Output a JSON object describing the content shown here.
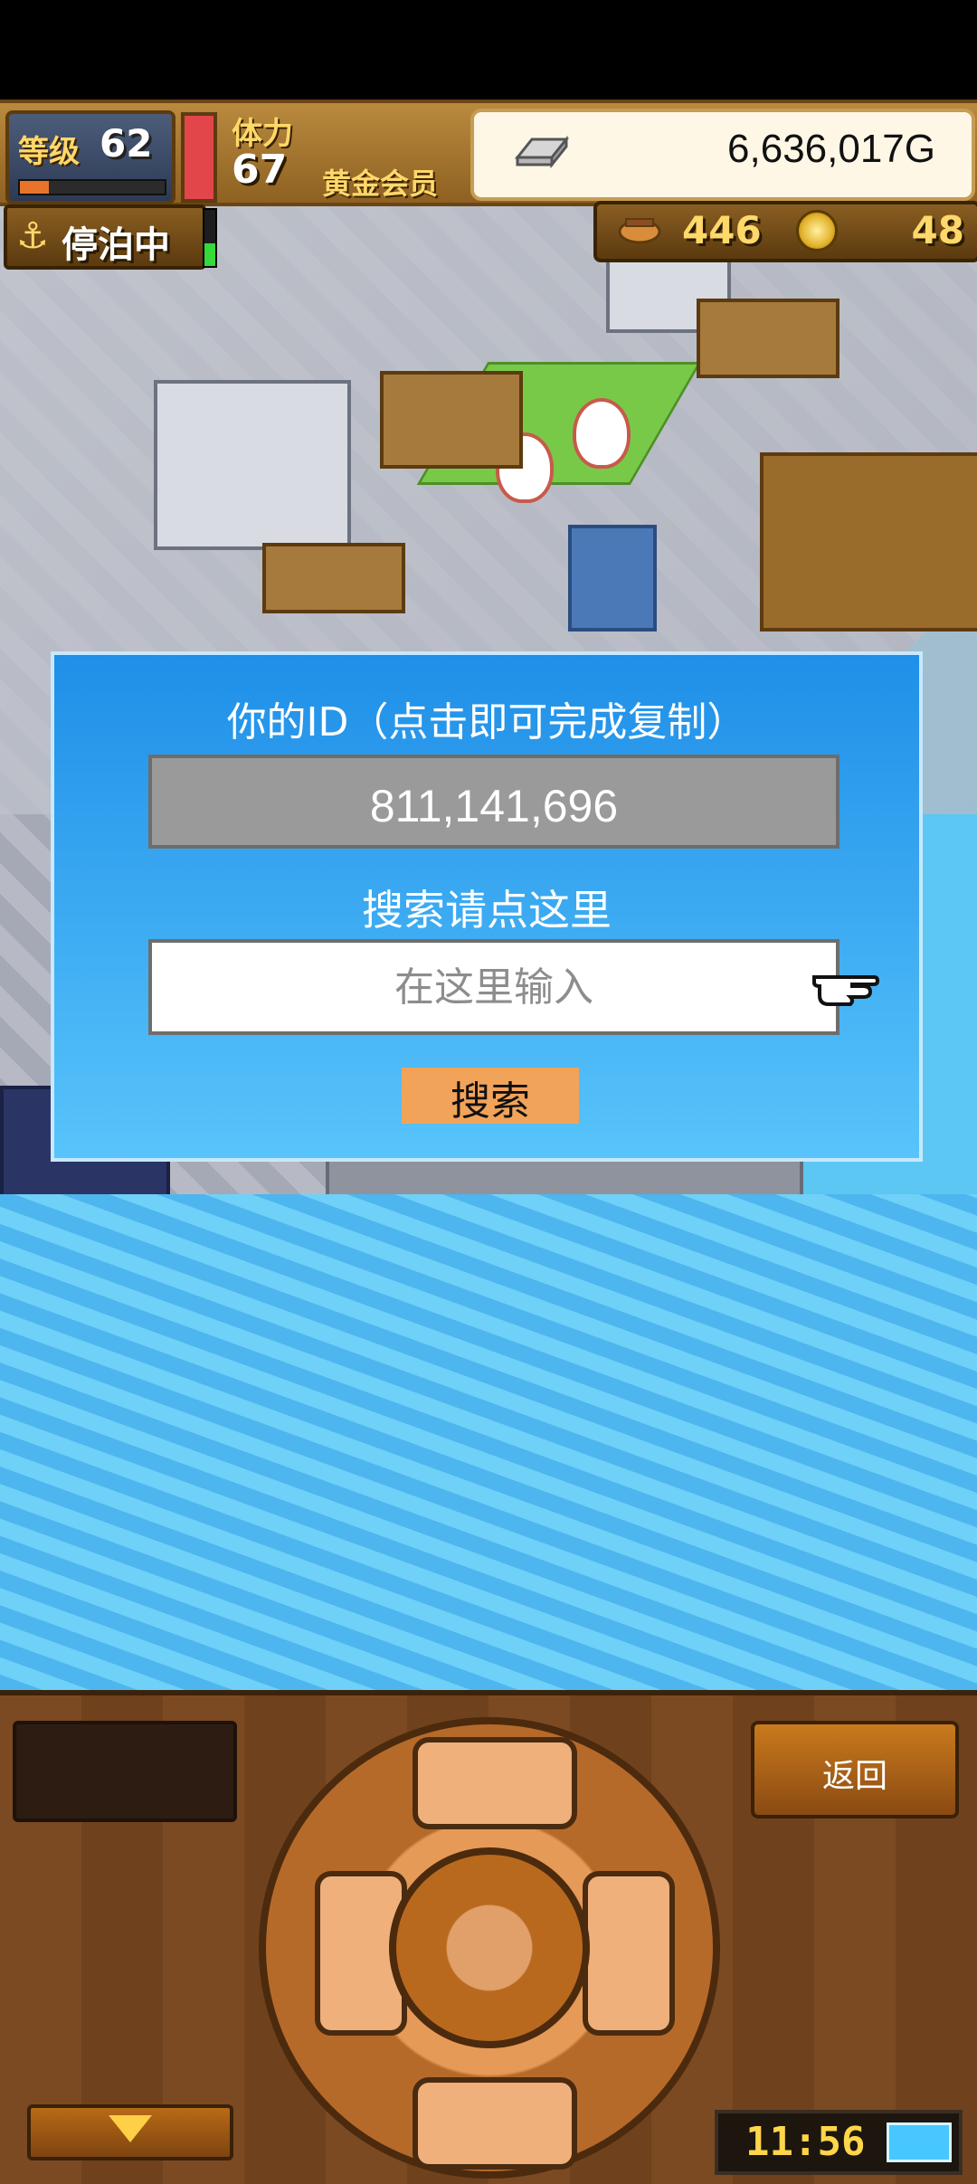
{
  "hud": {
    "level_label": "等级",
    "level_value": "62",
    "exp_progress": 0.2,
    "stamina_label": "体力",
    "stamina_value": "67",
    "stamina_progress": 1.0,
    "member_label": "黄金会员",
    "gold_value": "6,636,017G",
    "docked_label": "停泊中",
    "docked_indicator_progress": 0.4,
    "resource_1": "446",
    "resource_2": "48"
  },
  "dialog": {
    "id_title": "你的ID（点击即可完成复制）",
    "id_value": "811,141,696",
    "search_title": "搜索请点这里",
    "search_placeholder": "在这里输入",
    "search_button": "搜索"
  },
  "bottom": {
    "back_label": "返回",
    "clock_time": "11:56"
  },
  "icons": {
    "anchor": "anchor-icon",
    "silver": "silver-bar-icon",
    "ship": "ship-icon",
    "coin": "coin-icon",
    "pointer": "pointing-hand-icon",
    "down": "down-arrow-icon",
    "battery": "battery-charging-icon"
  },
  "colors": {
    "dialog_top": "#1f8fe8",
    "dialog_bottom": "#58c4fb",
    "id_box": "#9a9a9a",
    "search_button": "#f2a35a",
    "hud_brown": "#8e6122",
    "water": "#4db6ee"
  }
}
